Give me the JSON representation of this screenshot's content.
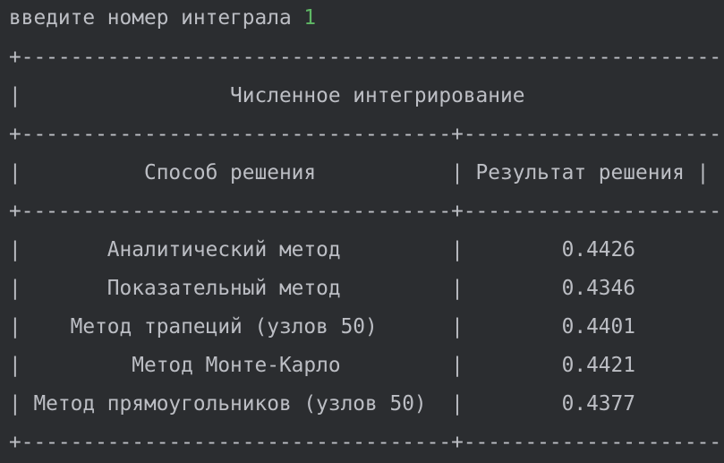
{
  "console": {
    "prompt": {
      "text": "введите номер интеграла ",
      "input": "1"
    },
    "table": {
      "border_top": "+-----------------------------------------------------------------+",
      "title_row": "|                 Численное интегрирование                        |",
      "border_mid": "+-----------------------------------+------------------------------+",
      "header_row": "|          Способ решения           | Результат решения |",
      "rows": [
        "|       Аналитический метод         |        0.4426         |",
        "|       Показательный метод         |        0.4346         |",
        "|    Метод трапеций (узлов 50)      |        0.4401         |",
        "|         Метод Монте-Карло         |        0.4421         |",
        "| Метод прямоугольников (узлов 50)  |        0.4377         |"
      ]
    }
  }
}
